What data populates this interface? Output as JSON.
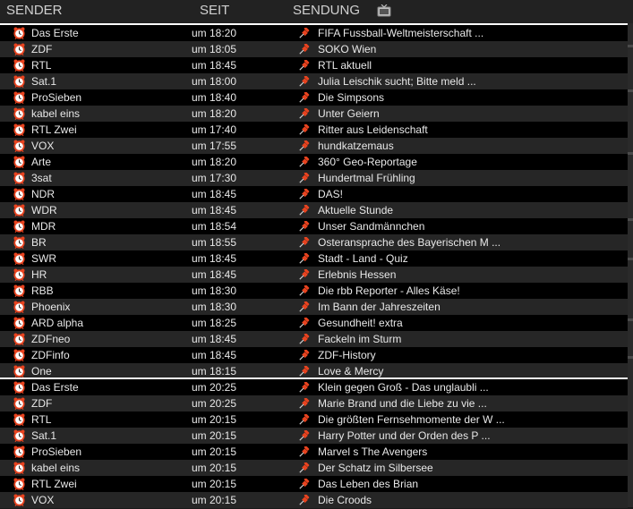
{
  "header": {
    "sender_label": "SENDER",
    "seit_label": "SEIT",
    "sendung_label": "SENDUNG",
    "tv_icon": "tv-icon"
  },
  "icons": {
    "alarm": "alarm-clock-icon",
    "pin": "pushpin-icon"
  },
  "colors": {
    "alarm": "#e8431f",
    "pin": "#e8431f",
    "separator": "#ffffff"
  },
  "now": [
    {
      "sender": "Das Erste",
      "time": "um 18:20",
      "show": "FIFA Fussball-Weltmeisterschaft ..."
    },
    {
      "sender": "ZDF",
      "time": "um 18:05",
      "show": "SOKO Wien"
    },
    {
      "sender": "RTL",
      "time": "um 18:45",
      "show": "RTL aktuell"
    },
    {
      "sender": "Sat.1",
      "time": "um 18:00",
      "show": "Julia Leischik sucht; Bitte meld ..."
    },
    {
      "sender": "ProSieben",
      "time": "um 18:40",
      "show": "Die Simpsons"
    },
    {
      "sender": "kabel eins",
      "time": "um 18:20",
      "show": "Unter Geiern"
    },
    {
      "sender": "RTL Zwei",
      "time": "um 17:40",
      "show": "Ritter aus Leidenschaft"
    },
    {
      "sender": "VOX",
      "time": "um 17:55",
      "show": "hundkatzemaus"
    },
    {
      "sender": "Arte",
      "time": "um 18:20",
      "show": "360° Geo-Reportage"
    },
    {
      "sender": "3sat",
      "time": "um 17:30",
      "show": "Hundertmal Frühling"
    },
    {
      "sender": "NDR",
      "time": "um 18:45",
      "show": "DAS!"
    },
    {
      "sender": "WDR",
      "time": "um 18:45",
      "show": "Aktuelle Stunde"
    },
    {
      "sender": "MDR",
      "time": "um 18:54",
      "show": "Unser Sandmännchen"
    },
    {
      "sender": "BR",
      "time": "um 18:55",
      "show": "Osteransprache des Bayerischen M ..."
    },
    {
      "sender": "SWR",
      "time": "um 18:45",
      "show": "Stadt - Land - Quiz"
    },
    {
      "sender": "HR",
      "time": "um 18:45",
      "show": "Erlebnis Hessen"
    },
    {
      "sender": "RBB",
      "time": "um 18:30",
      "show": "Die rbb Reporter - Alles Käse!"
    },
    {
      "sender": "Phoenix",
      "time": "um 18:30",
      "show": "Im Bann der Jahreszeiten"
    },
    {
      "sender": "ARD alpha",
      "time": "um 18:25",
      "show": "Gesundheit! extra"
    },
    {
      "sender": "ZDFneo",
      "time": "um 18:45",
      "show": "Fackeln im Sturm"
    },
    {
      "sender": "ZDFinfo",
      "time": "um 18:45",
      "show": "ZDF-History"
    },
    {
      "sender": "One",
      "time": "um 18:15",
      "show": "Love & Mercy"
    }
  ],
  "later": [
    {
      "sender": "Das Erste",
      "time": "um 20:25",
      "show": "Klein gegen Groß - Das unglaubli ..."
    },
    {
      "sender": "ZDF",
      "time": "um 20:25",
      "show": "Marie Brand und die Liebe zu vie ..."
    },
    {
      "sender": "RTL",
      "time": "um 20:15",
      "show": "Die größten Fernsehmomente der W ..."
    },
    {
      "sender": "Sat.1",
      "time": "um 20:15",
      "show": "Harry Potter und der Orden des P ..."
    },
    {
      "sender": "ProSieben",
      "time": "um 20:15",
      "show": "Marvel s The Avengers"
    },
    {
      "sender": "kabel eins",
      "time": "um 20:15",
      "show": "Der Schatz im Silbersee"
    },
    {
      "sender": "RTL Zwei",
      "time": "um 20:15",
      "show": "Das Leben des Brian"
    },
    {
      "sender": "VOX",
      "time": "um 20:15",
      "show": "Die Croods"
    }
  ]
}
